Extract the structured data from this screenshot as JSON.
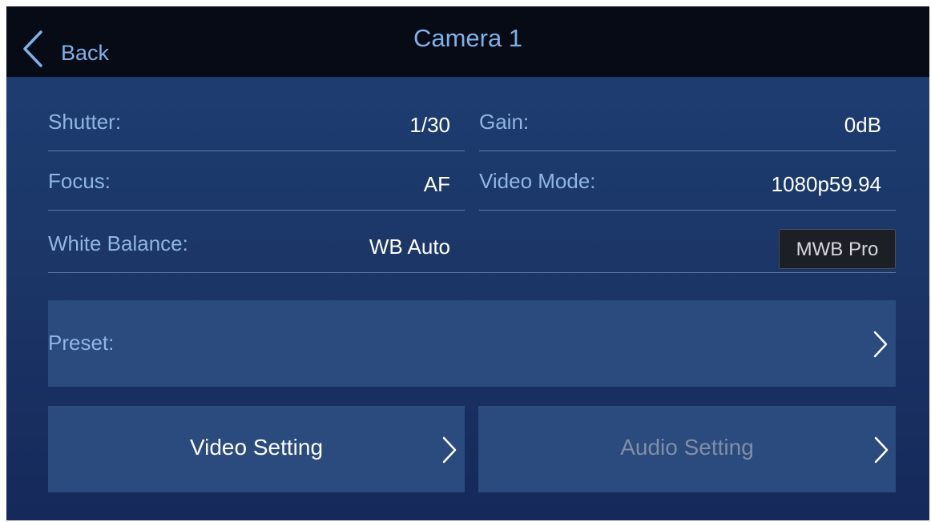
{
  "header": {
    "back_label": "Back",
    "title": "Camera 1"
  },
  "fields": {
    "shutter": {
      "label": "Shutter:",
      "value": "1/30"
    },
    "gain": {
      "label": "Gain:",
      "value": "0dB"
    },
    "focus": {
      "label": "Focus:",
      "value": "AF"
    },
    "video_mode": {
      "label": "Video Mode:",
      "value": "1080p59.94"
    },
    "white_balance": {
      "label": "White Balance:",
      "value": "WB Auto"
    }
  },
  "mwb_button": {
    "label": "MWB Pro"
  },
  "preset": {
    "label": "Preset:"
  },
  "tiles": {
    "video": {
      "label": "Video Setting"
    },
    "audio": {
      "label": "Audio Setting"
    }
  },
  "icons": {
    "back": "chevron-left-icon",
    "next": "chevron-right-icon"
  },
  "colors": {
    "topbar": "#060b16",
    "accent_text": "#7fb1e6",
    "label_text": "#8fb6e2",
    "tile_bg": "#2b4a7e",
    "disabled_text": "#7f8fa6"
  }
}
